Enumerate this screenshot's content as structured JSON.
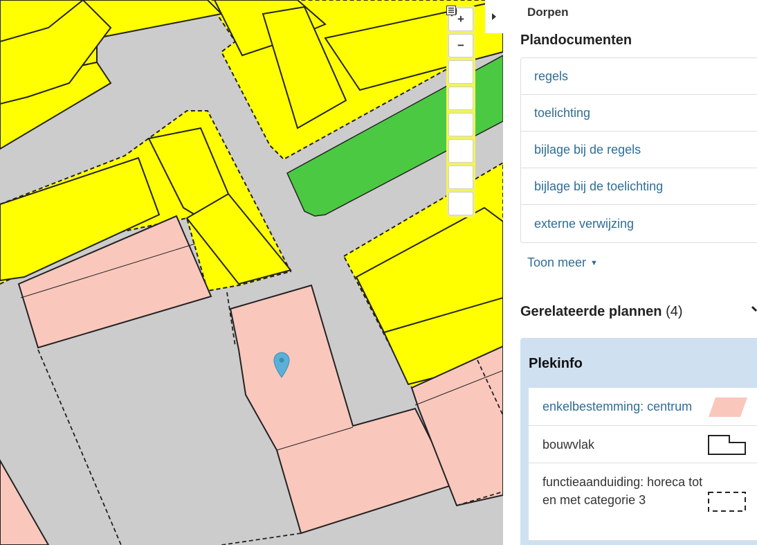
{
  "map": {
    "controls": [
      {
        "name": "zoom-in-button",
        "label": "+",
        "icon": "plus"
      },
      {
        "name": "zoom-out-button",
        "label": "−",
        "icon": "minus"
      },
      {
        "name": "layers-button",
        "icon": "layers-icon"
      },
      {
        "name": "settings-button",
        "icon": "gear-icon"
      },
      {
        "name": "print-button",
        "icon": "printer-icon"
      },
      {
        "name": "fullscreen-button",
        "icon": "fullscreen-icon"
      },
      {
        "name": "pan-button",
        "icon": "move-icon"
      },
      {
        "name": "legend-button",
        "icon": "list-icon"
      }
    ],
    "colors": {
      "road": "#cccccc",
      "centrum": "#f9c7bc",
      "wonen": "#ffff00",
      "groen": "#4cc943",
      "marker": "#5ab0d6"
    }
  },
  "panel": {
    "location": "Dorpen",
    "documents_title": "Plandocumenten",
    "documents": [
      "regels",
      "toelichting",
      "bijlage bij de regels",
      "bijlage bij de toelichting",
      "externe verwijzing"
    ],
    "show_more": "Toon meer",
    "related_label": "Gerelateerde plannen",
    "related_count": "(4)",
    "plekinfo_title": "Plekinfo",
    "plekinfo_items": [
      {
        "label": "enkelbestemming: centrum",
        "legend": "pink-parallelogram",
        "link": true
      },
      {
        "label": "bouwvlak",
        "legend": "building-outline",
        "link": false
      },
      {
        "label": "functieaanduiding: horeca tot en met categorie 3",
        "legend": "dashed-rect",
        "link": false
      }
    ]
  }
}
